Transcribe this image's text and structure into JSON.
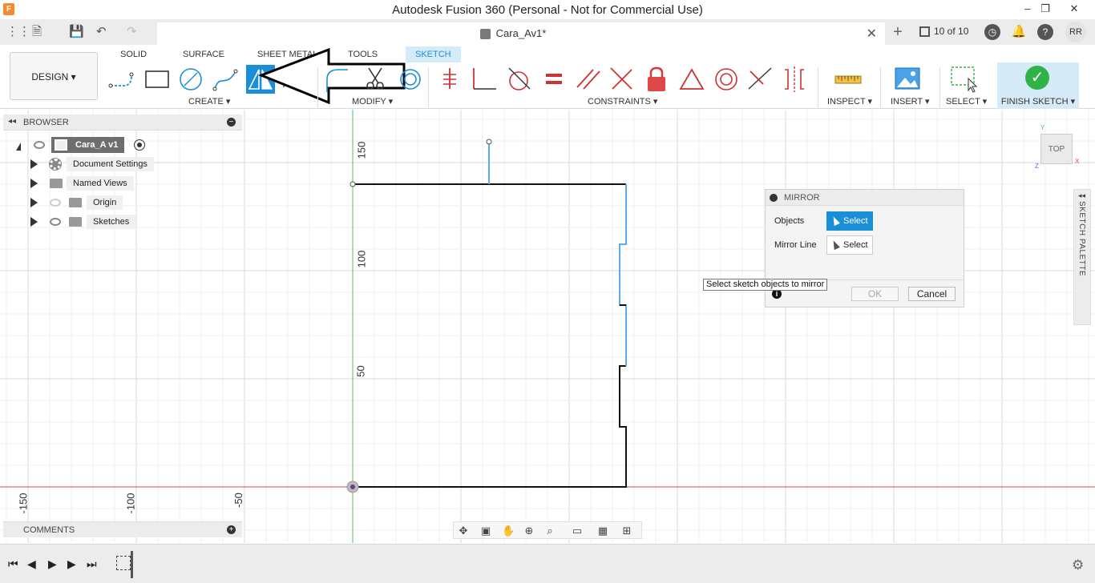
{
  "window": {
    "title": "Autodesk Fusion 360 (Personal - Not for Commercial Use)",
    "app_icon": "F",
    "minimize": "–",
    "restore": "❐",
    "close": "✕"
  },
  "tabs": {
    "document_name": "Cara_Av1*",
    "close": "✕",
    "new_tab": "+",
    "page_count": "10 of 10",
    "user_initials": "RR"
  },
  "quick_access": {
    "grid_icon": "⋮⋮",
    "file_icon": "🗎",
    "save_icon": "💾",
    "undo_icon": "↶",
    "redo_icon": "↷"
  },
  "toolbar": {
    "workspace": "DESIGN ▾",
    "workspace_tabs": [
      "SOLID",
      "SURFACE",
      "SHEET METAL",
      "TOOLS",
      "SKETCH"
    ],
    "groups": {
      "create": "CREATE ▾",
      "modify": "MODIFY ▾",
      "constraints": "CONSTRAINTS ▾",
      "inspect": "INSPECT ▾",
      "insert": "INSERT ▾",
      "select": "SELECT ▾",
      "finish": "FINISH SKETCH ▾"
    },
    "finish_check": "✓"
  },
  "browser": {
    "title": "BROWSER",
    "collapse": "◂◂",
    "minus": "−",
    "root": "Cara_A v1",
    "items": [
      {
        "label": "Document Settings"
      },
      {
        "label": "Named Views"
      },
      {
        "label": "Origin"
      },
      {
        "label": "Sketches"
      }
    ]
  },
  "axis_labels": {
    "y": [
      "150",
      "100",
      "50"
    ],
    "x": [
      "-150",
      "-100",
      "-50"
    ]
  },
  "viewcube": {
    "face": "TOP",
    "y": "Y",
    "x": "X",
    "z": "Z"
  },
  "mirror_dialog": {
    "title": "MIRROR",
    "objects_label": "Objects",
    "objects_button": "Select",
    "mirror_line_label": "Mirror Line",
    "mirror_line_button": "Select",
    "ok": "OK",
    "cancel": "Cancel",
    "info": "i"
  },
  "tooltip": "Select sketch objects to mirror",
  "sketch_palette": {
    "label": "SKETCH PALETTE",
    "arrow": "◂◂"
  },
  "comments": {
    "title": "COMMENTS",
    "plus": "+"
  },
  "timeline": {
    "first": "⏮",
    "prev": "◀",
    "play": "▶",
    "next": "▶",
    "last": "⏭",
    "gear": "⚙"
  },
  "colors": {
    "accent": "#1a8fd8",
    "sketch_line": "#111111",
    "constrained_line": "#5aaee6",
    "x_axis": "#e04848",
    "y_axis": "#58c25a",
    "finish_green": "#2fb349"
  }
}
